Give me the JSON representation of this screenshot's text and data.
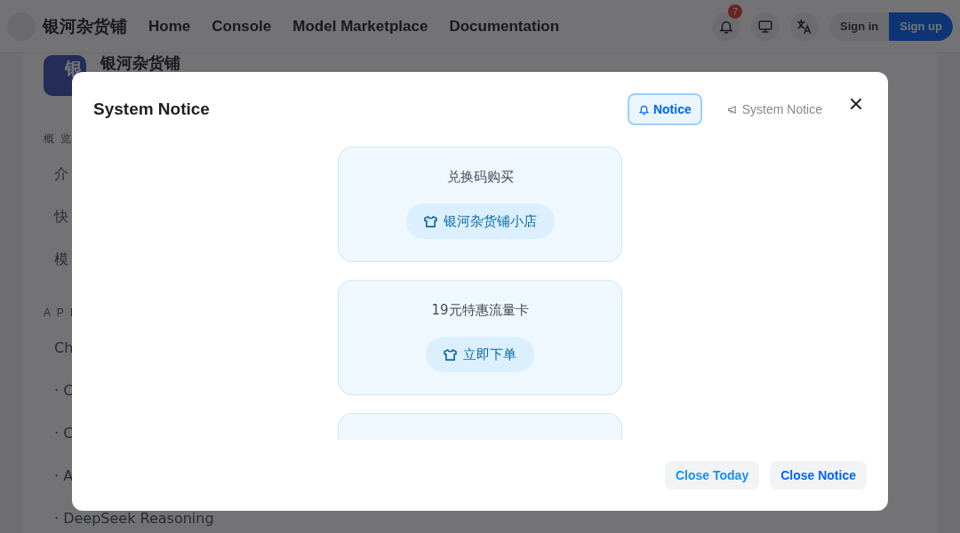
{
  "navbar": {
    "brand": "银河杂货铺",
    "links": [
      "Home",
      "Console",
      "Model Marketplace",
      "Documentation"
    ],
    "notification_count": "7",
    "sign_in": "Sign in",
    "sign_up": "Sign up"
  },
  "page": {
    "logo_text": "银",
    "site_name": "银河杂货铺",
    "sidebar": [
      {
        "title": "概 览",
        "items": [
          "介",
          "快",
          "模"
        ]
      },
      {
        "title": "A P I",
        "items": [
          "Ch",
          "· C",
          "· C",
          "· A",
          "· DeepSeek Reasoning"
        ]
      }
    ]
  },
  "dialog": {
    "title": "System Notice",
    "tabs": [
      {
        "label": "Notice",
        "selected": true
      },
      {
        "label": "System Notice",
        "selected": false
      }
    ],
    "cards": [
      {
        "title": "兑换码购买",
        "button": "银河杂货铺小店"
      },
      {
        "title": "19元特惠流量卡",
        "button": "立即下单"
      }
    ],
    "buttons": [
      {
        "label": "Close Today",
        "kind": "secondary"
      },
      {
        "label": "Close Notice",
        "kind": "primary"
      }
    ]
  }
}
